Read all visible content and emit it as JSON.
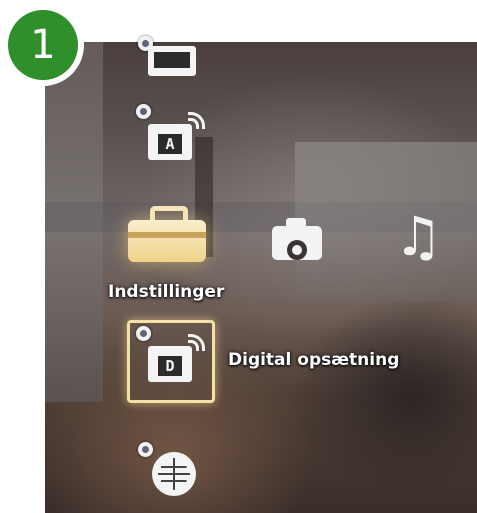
{
  "step_badge": {
    "number": "1",
    "color": "#2f8f2a"
  },
  "menu": {
    "categories": [
      {
        "name": "toolbox-icon",
        "label": "Indstillinger",
        "selected": true,
        "color": "#f0d28a"
      },
      {
        "name": "camera-icon",
        "label": ""
      },
      {
        "name": "music-note-icon",
        "label": ""
      }
    ],
    "settings_items": [
      {
        "name": "picture-settings-icon",
        "screen_text": "",
        "selected": false
      },
      {
        "name": "analog-setup-icon",
        "screen_text": "A",
        "selected": false
      },
      {
        "name": "digital-setup-icon",
        "screen_text": "D",
        "selected": true,
        "label": "Digital opsætning"
      },
      {
        "name": "network-settings-icon",
        "screen_text": "",
        "selected": false
      }
    ],
    "music_glyph": "♫",
    "accent_color": "#f3e1a8"
  }
}
